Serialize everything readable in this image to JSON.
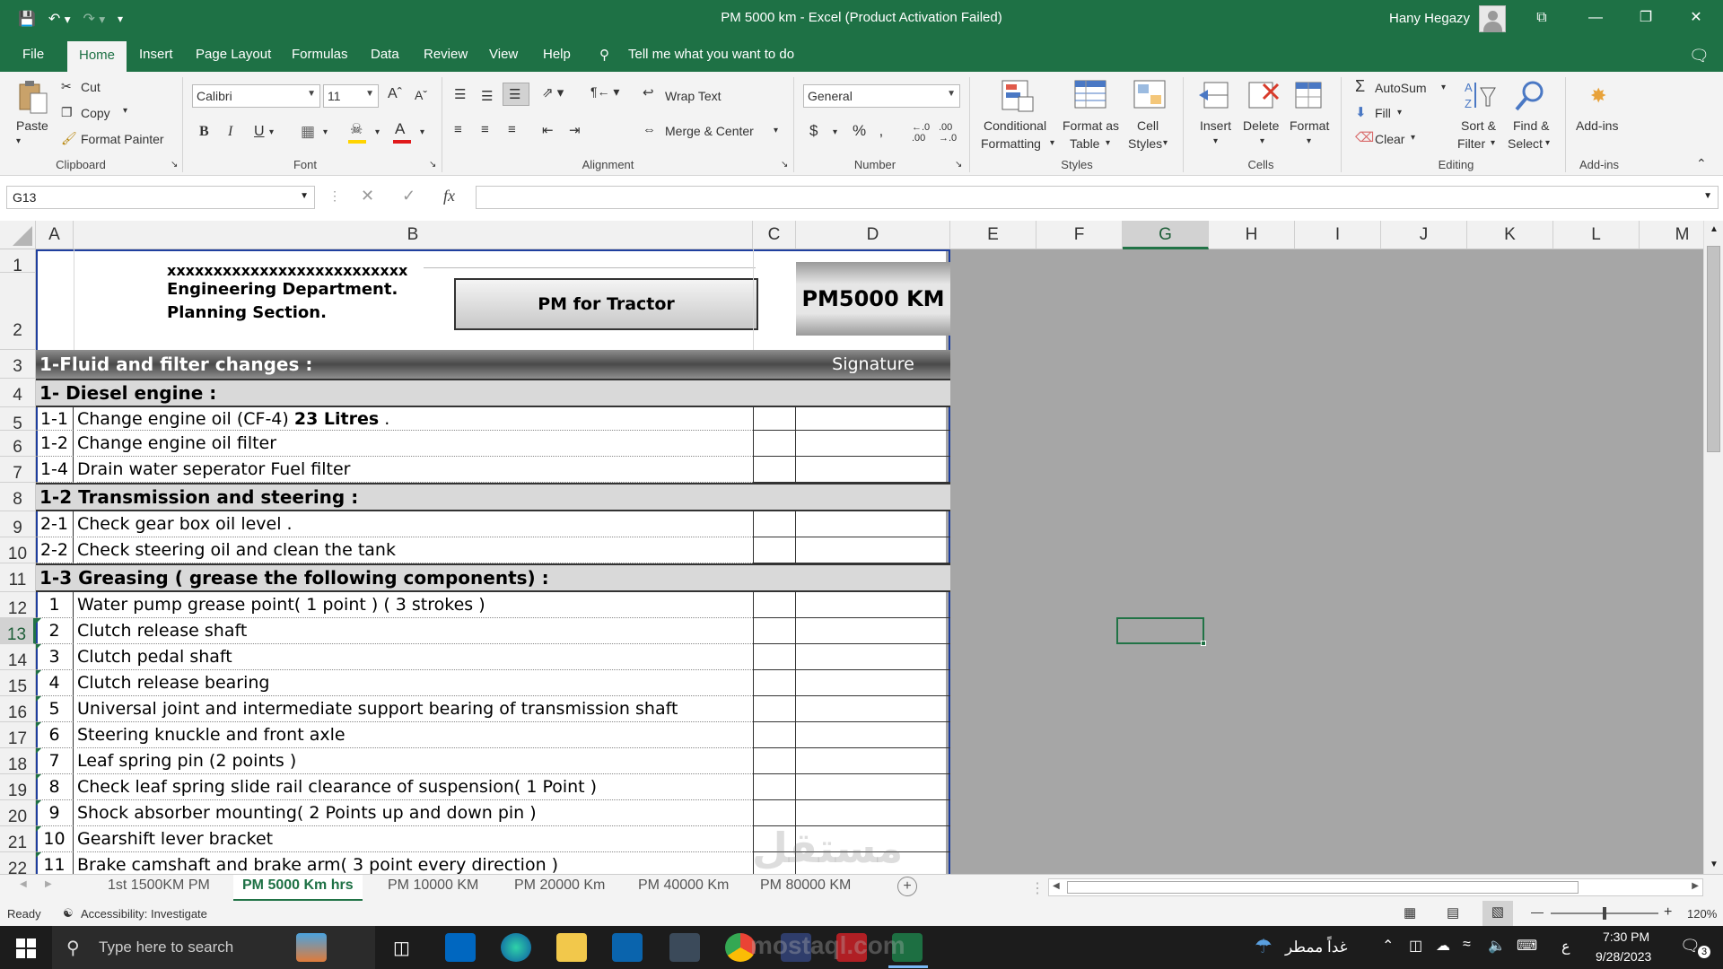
{
  "window": {
    "title": "PM 5000 km  -  Excel (Product Activation Failed)",
    "user": "Hany Hegazy",
    "qat_icons": [
      "save-icon",
      "undo-icon",
      "redo-icon",
      "customize-icon"
    ],
    "controls": {
      "ribbon_display": "⧉",
      "minimize": "—",
      "restore": "❐",
      "close": "✕"
    }
  },
  "menu": {
    "tabs": [
      "File",
      "Home",
      "Insert",
      "Page Layout",
      "Formulas",
      "Data",
      "Review",
      "View",
      "Help"
    ],
    "active": "Home",
    "tell_me": "Tell me what you want to do"
  },
  "ribbon": {
    "clipboard": {
      "paste": "Paste",
      "cut": "Cut",
      "copy": "Copy",
      "format_painter": "Format Painter",
      "label": "Clipboard"
    },
    "font": {
      "name": "Calibri",
      "size": "11",
      "bold": "B",
      "italic": "I",
      "underline": "U",
      "label": "Font",
      "fill_color": "#ffd400",
      "font_color": "#e0191b"
    },
    "alignment": {
      "wrap_text": "Wrap Text",
      "merge_center": "Merge & Center",
      "label": "Alignment"
    },
    "number": {
      "format": "General",
      "currency": "$",
      "percent": "%",
      "label": "Number"
    },
    "styles": {
      "conditional": "Conditional",
      "conditional2": "Formatting",
      "format_as": "Format as",
      "format_as2": "Table",
      "cell": "Cell",
      "cell2": "Styles",
      "label": "Styles"
    },
    "cells": {
      "insert": "Insert",
      "delete": "Delete",
      "format": "Format",
      "label": "Cells"
    },
    "editing": {
      "autosum": "AutoSum",
      "fill": "Fill",
      "clear": "Clear",
      "sort": "Sort &",
      "sort2": "Filter",
      "find": "Find &",
      "find2": "Select",
      "label": "Editing"
    },
    "addins": {
      "addins": "Add-ins",
      "label": "Add-ins"
    }
  },
  "formula_bar": {
    "name_box": "G13",
    "fx": "fx",
    "formula": ""
  },
  "columns": [
    "A",
    "B",
    "C",
    "D",
    "E",
    "F",
    "G",
    "H",
    "I",
    "J",
    "K",
    "L",
    "M"
  ],
  "selected_column": "G",
  "selected_row": "13",
  "rows": [
    "1",
    "2",
    "3",
    "4",
    "5",
    "6",
    "7",
    "8",
    "9",
    "10",
    "11",
    "12",
    "13",
    "14",
    "15",
    "16",
    "17",
    "18",
    "19",
    "20",
    "21",
    "22"
  ],
  "sheet": {
    "header_line1": "xxxxxxxxxxxxxxxxxxxxxxxxxx",
    "header_line2": "Engineering Department.",
    "header_line3": "Planning Section.",
    "title_box": "PM for Tractor",
    "pm_label": "PM5000 KM",
    "section1": "1-Fluid and filter changes :",
    "signature": "Signature",
    "sub_diesel": "1- Diesel engine  :",
    "items_diesel": [
      {
        "no": "1-1",
        "text": "Change engine oil (CF-4) ",
        "bold": "23 Litres",
        " tail": " ."
      },
      {
        "no": "1-2",
        "text": "Change engine oil filter"
      },
      {
        "no": "1-4",
        "text": "Drain water seperator Fuel filter"
      }
    ],
    "sub_trans": "1-2 Transmission and steering  :",
    "items_trans": [
      {
        "no": "2-1",
        "text": "Check  gear box  oil  level  ."
      },
      {
        "no": "2-2",
        "text": "Check steering oil and clean the tank"
      }
    ],
    "sub_grease": "1-3 Greasing ( grease the following components)    :",
    "items_grease": [
      {
        "no": "1",
        "text": "Water pump grease point( 1 point ) ( 3 strokes )"
      },
      {
        "no": "2",
        "text": "Clutch release shaft"
      },
      {
        "no": "3",
        "text": "Clutch pedal shaft"
      },
      {
        "no": "4",
        "text": "Clutch release bearing"
      },
      {
        "no": "5",
        "text": "Universal joint and intermediate support bearing of transmission shaft"
      },
      {
        "no": "6",
        "text": "Steering knuckle and front axle"
      },
      {
        "no": "7",
        "text": "Leaf spring pin (2  points )"
      },
      {
        "no": "8",
        "text": "Check leaf spring slide rail clearance of suspension( 1 Point )"
      },
      {
        "no": "9",
        "text": "Shock absorber mounting( 2 Points up and down pin )"
      },
      {
        "no": "10",
        "text": "Gearshift lever bracket"
      },
      {
        "no": "11",
        "text": "Brake camshaft and brake arm( 3 point every direction )"
      }
    ]
  },
  "sheet_tabs": [
    "1st 1500KM PM",
    "PM 5000 Km hrs",
    "PM 10000 KM",
    "PM 20000 Km",
    "PM 40000 Km",
    "PM 80000 KM"
  ],
  "active_sheet": "PM 5000 Km hrs",
  "status": {
    "ready": "Ready",
    "accessibility": "Accessibility: Investigate",
    "zoom": "120%"
  },
  "taskbar": {
    "search_placeholder": "Type here to search",
    "weather": "غداً ممطر",
    "lang": "ع",
    "time": "7:30 PM",
    "date": "9/28/2023",
    "notifications": "3"
  },
  "watermark": {
    "ar": "مستقل",
    "en": "mostaql.com"
  }
}
